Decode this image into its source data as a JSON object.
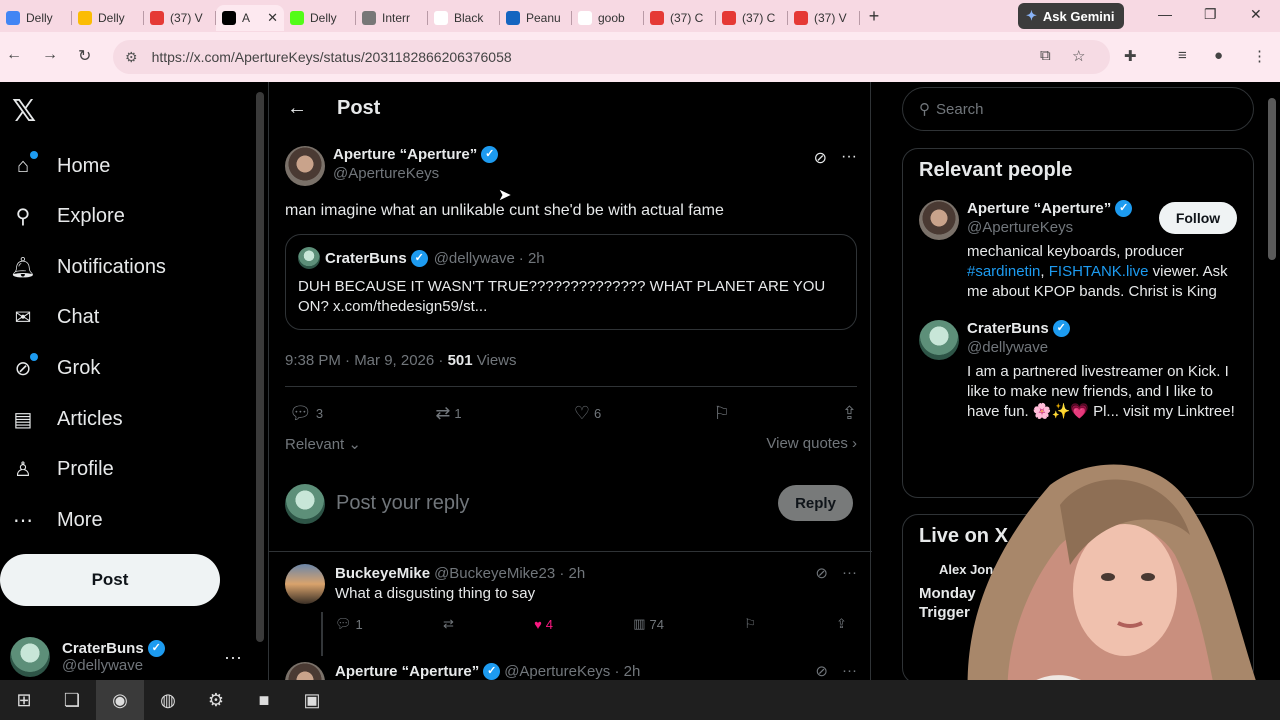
{
  "browser": {
    "tabs": [
      {
        "label": "Delly",
        "fav": "#4285f4"
      },
      {
        "label": "Delly",
        "fav": "#fbbc04"
      },
      {
        "label": "(37) V",
        "fav": "#e53935"
      },
      {
        "label": "A",
        "fav": "#000000",
        "active": true
      },
      {
        "label": "Delly",
        "fav": "#53fc18"
      },
      {
        "label": "Interr",
        "fav": "#777777"
      },
      {
        "label": "Black",
        "fav": "#ffffff"
      },
      {
        "label": "Peanu",
        "fav": "#1565c0"
      },
      {
        "label": "goob",
        "fav": "#ffffff"
      },
      {
        "label": "(37) C",
        "fav": "#e53935"
      },
      {
        "label": "(37) C",
        "fav": "#e53935"
      },
      {
        "label": "(37) V",
        "fav": "#e53935"
      }
    ],
    "gemini_label": "Ask Gemini",
    "url": "https://x.com/ApertureKeys/status/2031182866206376058"
  },
  "nav": {
    "items": [
      {
        "label": "Home",
        "icon": "home-icon",
        "glyph": "⌂",
        "dot": true
      },
      {
        "label": "Explore",
        "icon": "search-icon",
        "glyph": "⚲"
      },
      {
        "label": "Notifications",
        "icon": "bell-icon",
        "glyph": "🔔︎"
      },
      {
        "label": "Chat",
        "icon": "mail-icon",
        "glyph": "✉"
      },
      {
        "label": "Grok",
        "icon": "grok-icon",
        "glyph": "⊘",
        "dot": true
      },
      {
        "label": "Articles",
        "icon": "articles-icon",
        "glyph": "▤"
      },
      {
        "label": "Profile",
        "icon": "person-icon",
        "glyph": "♙"
      },
      {
        "label": "More",
        "icon": "more-circle-icon",
        "glyph": "⋯"
      }
    ],
    "post_label": "Post",
    "me": {
      "name": "CraterBuns",
      "handle": "@dellywave"
    }
  },
  "header": {
    "title": "Post"
  },
  "post": {
    "name": "Aperture “Aperture”",
    "handle": "@ApertureKeys",
    "text": "man imagine what an unlikable cunt she'd be with actual fame",
    "quote": {
      "name": "CraterBuns",
      "handle": "@dellywave",
      "time": "· 2h",
      "text": "DUH BECAUSE IT WASN'T TRUE??????????????  WHAT PLANET ARE YOU ON? x.com/thedesign59/st..."
    },
    "timestamp": "9:38 PM · Mar 9, 2026 · ",
    "views": "501",
    "views_label": " Views",
    "replies": "3",
    "reposts": "1",
    "likes": "6",
    "sort_label": "Relevant",
    "quotes_label": "View quotes"
  },
  "reply_box": {
    "placeholder": "Post your reply",
    "button": "Reply"
  },
  "replies": [
    {
      "name": "BuckeyeMike",
      "handle": "@BuckeyeMike23 · 2h",
      "text": "What a disgusting thing to say",
      "replies": "1",
      "reposts": "",
      "likes": "4",
      "views": "74"
    },
    {
      "name": "Aperture “Aperture”",
      "handle": "@ApertureKeys · 2h",
      "text": ""
    }
  ],
  "sidebar": {
    "search_placeholder": "Search",
    "relevant_title": "Relevant people",
    "people": [
      {
        "name": "Aperture “Aperture”",
        "handle": "@ApertureKeys",
        "follow": "Follow",
        "bio_a": "mechanical keyboards, producer ",
        "bio_link1": "#sardinetin",
        "bio_b": ", ",
        "bio_link2": "FISHTANK.live",
        "bio_c": " viewer. Ask me about KPOP bands. Christ is King"
      },
      {
        "name": "CraterBuns",
        "handle": "@dellywave",
        "bio": "I am a partnered livestreamer on Kick. I like to make new friends, and I like to have fun. 🌸✨💗 Pl... visit my Linktree!"
      }
    ],
    "live_title": "Live on X",
    "live_host": "Alex Jone",
    "live_line": "Monday",
    "live_line2": "Trigger"
  }
}
